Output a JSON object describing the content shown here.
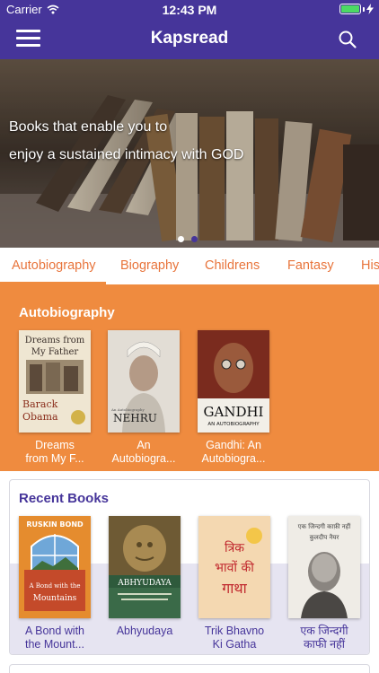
{
  "status_bar": {
    "carrier": "Carrier",
    "time": "12:43 PM"
  },
  "nav": {
    "title": "Kapsread",
    "menu_icon": "hamburger-menu-icon",
    "search_icon": "search-icon"
  },
  "hero": {
    "line1": "Books that enable you to",
    "line2": "enjoy a sustained intimacy with GOD",
    "slides": 2,
    "active_slide": 2
  },
  "tabs": [
    "Autobiography",
    "Biography",
    "Childrens",
    "Fantasy",
    "His"
  ],
  "active_tab": "Autobiography",
  "featured": {
    "title": "Autobiography",
    "books": [
      {
        "label": "Dreams\nfrom My F...",
        "cover_lines": [
          "Dreams from",
          "My Father"
        ],
        "cover_author": [
          "Barack",
          "Obama"
        ]
      },
      {
        "label": "An\nAutobiogra...",
        "cover_author": "NEHRU",
        "cover_sub": "An Autobiography"
      },
      {
        "label": "Gandhi: An\nAutobiogra...",
        "cover_title": "GANDHI",
        "cover_sub": "AN AUTOBIOGRAPHY"
      }
    ]
  },
  "recent": {
    "title": "Recent Books",
    "books": [
      {
        "label": "A Bond with\nthe Mount...",
        "cover_author": "RUSKIN BOND",
        "cover_title": "A Bond with the Mountains"
      },
      {
        "label": "Abhyudaya",
        "cover_title": "ABHYUDAYA"
      },
      {
        "label": "Trik Bhavno\nKi Gatha",
        "cover_title": "त्रिक भावों की गाथा"
      },
      {
        "label": "एक जिन्दगी\nकाफी नहीं",
        "cover_title": "एक जिन्दगी काफी नहीं",
        "cover_author": "कुलदीप नैयर"
      }
    ]
  },
  "colors": {
    "nav": "#46359a",
    "accent": "#ef8b3f",
    "tab_text": "#e8743b",
    "recent_band": "#e6e4f1"
  }
}
